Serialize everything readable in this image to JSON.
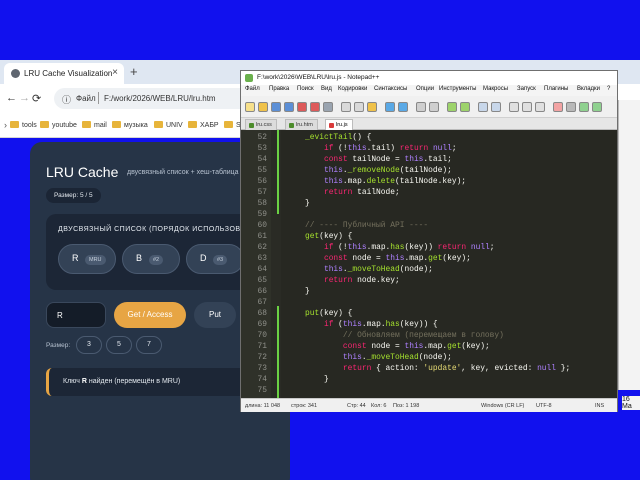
{
  "browser": {
    "tab_title": "LRU Cache Visualization",
    "tab_close": "×",
    "new_tab": "+",
    "nav": {
      "back": "←",
      "forward": "→",
      "reload": "⟳",
      "home": "⌂"
    },
    "address": {
      "info": "ⓘ",
      "label": "Файл",
      "path": "F:/work/2026/WEB/LRU/lru.htm"
    },
    "bookmarks": [
      "tools",
      "youtube",
      "mail",
      "музыка",
      "UNIV",
      "ХАБР",
      "SE"
    ]
  },
  "lru": {
    "title": "LRU Cache",
    "subtitle": "двусвязный список + хеш-таблица",
    "size_badge": "Размер: 5 / 5",
    "list_title": "ДВУСВЯЗНЫЙ СПИСОК (ПОРЯДОК ИСПОЛЬЗОВАНИЯ)",
    "nodes": [
      {
        "key": "R",
        "tag": "MRU"
      },
      {
        "key": "B",
        "tag": "#2"
      },
      {
        "key": "D",
        "tag": "#3"
      }
    ],
    "key_input_value": "R",
    "get_button": "Get / Access",
    "put_button": "Put",
    "size_label": "Размер:",
    "size_options": [
      "3",
      "5",
      "7"
    ],
    "status_prefix": "Ключ ",
    "status_key": "R",
    "status_suffix": " найден (перемещён в MRU)"
  },
  "npp": {
    "title": "F:\\work\\2026\\WEB\\LRU\\lru.js - Notepad++",
    "menu": [
      "Файл",
      "Правка",
      "Поиск",
      "Вид",
      "Кодировки",
      "Синтаксисы",
      "Опции",
      "Инструменты",
      "Макросы",
      "Запуск",
      "Плагины",
      "Вкладки",
      "?"
    ],
    "tabs": [
      "lru.css",
      "lru.htm",
      "lru.js"
    ],
    "active_tab": 2,
    "lines": [
      {
        "n": "52",
        "t": "    _evictTail() {"
      },
      {
        "n": "53",
        "t": "        if (!this.tail) return null;"
      },
      {
        "n": "54",
        "t": "        const tailNode = this.tail;"
      },
      {
        "n": "55",
        "t": "        this._removeNode(tailNode);"
      },
      {
        "n": "56",
        "t": "        this.map.delete(tailNode.key);"
      },
      {
        "n": "57",
        "t": "        return tailNode;"
      },
      {
        "n": "58",
        "t": "    }"
      },
      {
        "n": "59",
        "t": ""
      },
      {
        "n": "60",
        "t": "    // ---- Публичный API ----"
      },
      {
        "n": "61",
        "t": "    get(key) {"
      },
      {
        "n": "62",
        "t": "        if (!this.map.has(key)) return null;"
      },
      {
        "n": "63",
        "t": "        const node = this.map.get(key);"
      },
      {
        "n": "64",
        "t": "        this._moveToHead(node);"
      },
      {
        "n": "65",
        "t": "        return node.key;"
      },
      {
        "n": "66",
        "t": "    }"
      },
      {
        "n": "67",
        "t": ""
      },
      {
        "n": "68",
        "t": "    put(key) {"
      },
      {
        "n": "69",
        "t": "        if (this.map.has(key)) {"
      },
      {
        "n": "70",
        "t": "            // Обновляем (перемещаем в голову)"
      },
      {
        "n": "71",
        "t": "            const node = this.map.get(key);"
      },
      {
        "n": "72",
        "t": "            this._moveToHead(node);"
      },
      {
        "n": "73",
        "t": "            return { action: 'update', key, evicted: null };"
      },
      {
        "n": "74",
        "t": "        }"
      },
      {
        "n": "75",
        "t": ""
      }
    ],
    "status": {
      "length": "длина: 11 048",
      "lines": "строк: 341",
      "pos_line": "Стр: 44",
      "pos_col": "Кол: 6",
      "pos": "Поз: 1 198",
      "eol": "Windows (CR LF)",
      "enc": "UTF-8",
      "ins": "INS"
    }
  },
  "taskbar": {
    "clock_fragment": "16 Ma"
  },
  "colors": {
    "accent": "#e7a544",
    "card": "#263447",
    "editor_bg": "#272822",
    "desktop": "#1111ee"
  }
}
